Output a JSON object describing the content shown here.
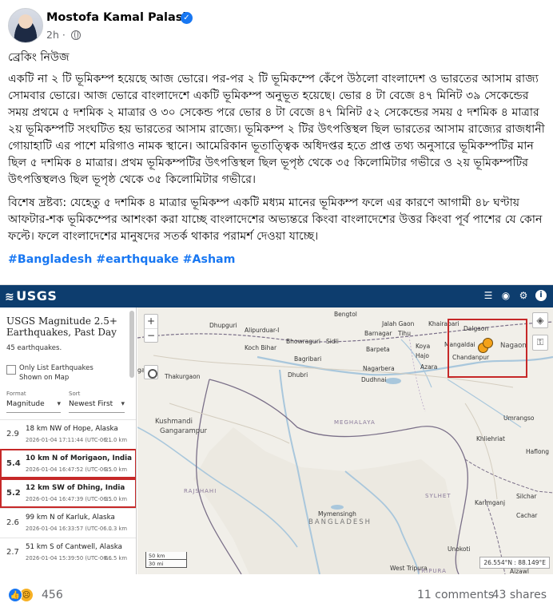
{
  "post": {
    "author": "Mostofa Kamal Palash",
    "time": "2h",
    "time_sep": "·",
    "kicker": "ব্রেকিং নিউজ",
    "paragraph1": "একটি না ২ টি ভূমিকম্প হয়েছে আজ ভোরে। পর-পর ২ টি ভূমিকম্পে কেঁপে উঠলো বাংলাদেশ ও ভারতের আসাম রাজ্য সোমবার ভোরে। আজ ভোরে বাংলাদেশে একটি ভূমিকম্প অনুভূত হয়েছে। ভোর ৪ টা বেজে ৪৭ মিনিট ৩৯ সেকেন্ডের সময় প্রথমে ৫ দশমিক ২ মাত্রার ও ৩০ সেকেন্ড পরে ভোর ৪ টা বেজে ৪৭ মিনিট ৫২ সেকেন্ডের সময় ৫ দশমিক ৪ মাত্রার ২য় ভূমিকম্পটি সংঘটিত হয় ভারতের আসাম রাজ্যে। ভূমিকম্প ২ টির উৎপত্তিস্থল ছিল ভারতের আসাম রাজ্যের রাজধানী গোয়াহাটি এর পাশে মরিগাও নামক স্থানে। আমেরিকান ভূতাত্ত্বিক অধিদপ্তর হতে প্রাপ্ত তথ্য অনুসারে ভূমিকম্পটির মান ছিল ৫ দশমিক ৪ মাত্রার। প্রথম ভূমিকম্পটির উৎপত্তিস্থল ছিল ভূপৃষ্ঠ থেকে ৩৫ কিলোমিটার গভীরে ও ২য় ভূমিকম্পটির উৎপত্তিস্থলও ছিল ভূপৃষ্ঠ থেকে ৩৫ কিলোমিটার গভীরে।",
    "paragraph2": "বিশেষ দ্রষ্টব্য: যেহেতু ৫ দশমিক ৪ মাত্রার ভূমিকম্প একটি মধ্যম মানের ভূমিকম্প ফলে এর কারণে আগামী ৪৮ ঘণ্টায় আফটার-শক ভূমিকম্পের আশংকা করা যাচ্ছে বাংলাদেশের অভ্যন্তরে কিংবা বাংলাদেশের উত্তর কিংবা পূর্ব পাশের যে কোন ফল্টে। ফলে বাংলাদেশের মানুষদের সতর্ক থাকার পরামর্শ দেওয়া যাচ্ছে।",
    "hashtags": "#Bangladesh #earthquake #Asham"
  },
  "usgs": {
    "logo": "USGS",
    "panel_title": "USGS Magnitude 2.5+ Earthquakes, Past Day",
    "count_text": "45 earthquakes.",
    "only_list_label": "Only List Earthquakes Shown on Map",
    "format_label": "Format",
    "format_value": "Magnitude",
    "sort_label": "Sort",
    "sort_value": "Newest First",
    "earthquakes": [
      {
        "mag": "2.9",
        "place": "18 km NW of Hope, Alaska",
        "time": "2026-01-04 17:11:44 (UTC-06...",
        "depth": "21.0 km",
        "highlight": false
      },
      {
        "mag": "5.4",
        "place": "10 km N of Morigaon, India",
        "time": "2026-01-04 16:47:52 (UTC-06...",
        "depth": "35.0 km",
        "highlight": true
      },
      {
        "mag": "5.2",
        "place": "12 km SW of Dhing, India",
        "time": "2026-01-04 16:47:39 (UTC-06...",
        "depth": "35.0 km",
        "highlight": true
      },
      {
        "mag": "2.6",
        "place": "99 km N of Karluk, Alaska",
        "time": "2026-01-04 16:33:57 (UTC-06...",
        "depth": "0.3 km",
        "highlight": false
      },
      {
        "mag": "2.7",
        "place": "51 km S of Cantwell, Alaska",
        "time": "2026-01-04 15:39:50 (UTC-06...",
        "depth": "66.5 km",
        "highlight": false
      }
    ],
    "map": {
      "zoom_in": "+",
      "zoom_out": "−",
      "scale_km": "50 km",
      "scale_mi": "30 mi",
      "coords": "26.554°N : 88.149°E",
      "places": {
        "bengtol": "Bengtol",
        "alipurduar": "Alipurduar-I",
        "dhupguri": "Dhupguri",
        "koch_bihar": "Koch Bihar",
        "bhowraguri": "Bhowraguri",
        "sidli": "Sidli",
        "jalah_gaon": "Jalah Gaon",
        "tihu": "Tihu",
        "barnagar": "Barnagar",
        "barpeta": "Barpeta",
        "koya": "Koya",
        "hajo": "Hajo",
        "bagribari": "Bagribari",
        "dhubri": "Dhubri",
        "nagarbera": "Nagarbera",
        "azara": "Azara",
        "dudhnai": "Dudhnai",
        "khairabari": "Khairabari",
        "dalgaon": "Dalgaon",
        "mangaldai": "Mangaldai",
        "chandanpur": "Chandanpur",
        "nagaon": "Nagaon",
        "ganj": "ganj",
        "thakurgaon": "Thakurgaon",
        "kushmandi": "Kushmandi",
        "gangarampur": "Gangarampur",
        "meghalaya": "MEGHALAYA",
        "umrangso": "Umrangso",
        "khliehriat": "Khliehriat",
        "haflong": "Haflong",
        "rajshahi": "RAJSHAHI",
        "mymensingh": "Mymensingh",
        "bangladesh": "BANGLADESH",
        "sylhet": "SYLHET",
        "karimganj": "Karimganj",
        "silchar": "Silchar",
        "cachar": "Cachar",
        "unokoti": "Unokoti",
        "west_tripura": "West Tripura",
        "tripura": "TRIPURA",
        "aizawl": "Aizawl"
      }
    }
  },
  "footer": {
    "reactions": "456",
    "comments": "11 comments",
    "shares": "43 shares"
  },
  "colors": {
    "usgs_bar": "#0d3d6e",
    "highlight_red": "#c62828",
    "facebook_blue": "#1877f2",
    "quake_marker": "#f4a21a"
  },
  "icons": [
    "verified-icon",
    "globe-icon",
    "zoom-in-icon",
    "zoom-out-icon",
    "locate-icon",
    "layers-icon",
    "key-icon",
    "like-icon",
    "sad-icon"
  ]
}
